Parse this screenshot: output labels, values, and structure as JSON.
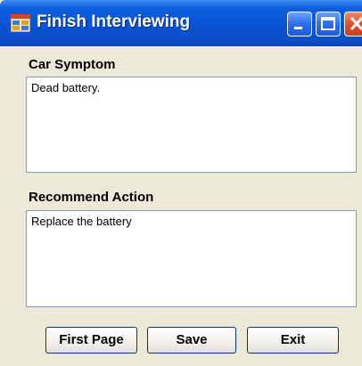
{
  "window": {
    "title": "Finish Interviewing",
    "icon": "app-form-icon"
  },
  "title_buttons": {
    "minimize_icon": "minimize-icon",
    "maximize_icon": "maximize-icon",
    "close_icon": "close-icon"
  },
  "car_symptom": {
    "label": "Car Symptom",
    "value": "Dead battery."
  },
  "recommend_action": {
    "label": "Recommend Action",
    "value": "Replace the battery"
  },
  "buttons": {
    "first_page": "First Page",
    "save": "Save",
    "exit": "Exit"
  },
  "colors": {
    "titlebar": "#0b5fe0",
    "window_background": "#ece9d8",
    "close_button": "#e0502b"
  }
}
